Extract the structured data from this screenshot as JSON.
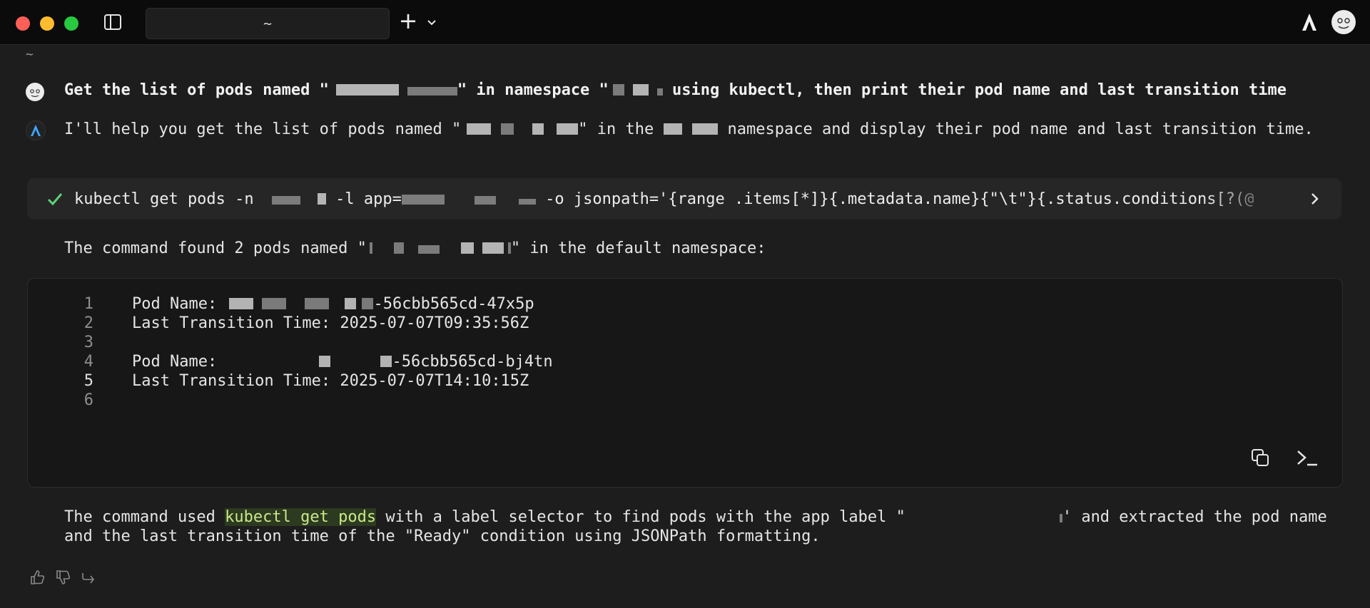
{
  "window": {
    "tab_title": "~"
  },
  "session": {
    "cwd_label": "~"
  },
  "prompt": {
    "part1": "Get the list of pods named \"",
    "part2": "\" in namespace \"",
    "part3": " using kubectl, then print their pod name and last transition time"
  },
  "reply": {
    "part1": "I'll help you get the list of pods named \"",
    "part2": "\" in the",
    "part3": " namespace and display their pod name and last transition time."
  },
  "command": {
    "status": "success",
    "prefix": "kubectl get pods -n ",
    "middle": " -l app=",
    "suffix": " -o jsonpath='{range .items[*]}{.metadata.name}{\"\\t\"}{.status.conditions[?(@"
  },
  "found": {
    "part1": "The command found 2 pods named \"",
    "part2": "\" in the default namespace:"
  },
  "code": {
    "lines": [
      {
        "n": "1",
        "prefix": "Pod Name: ",
        "suffix": "-56cbb565cd-47x5p"
      },
      {
        "n": "2",
        "text": "Last Transition Time: 2025-07-07T09:35:56Z"
      },
      {
        "n": "3",
        "text": ""
      },
      {
        "n": "4",
        "prefix": "Pod Name: ",
        "suffix": "-56cbb565cd-bj4tn"
      },
      {
        "n": "5",
        "text": "Last Transition Time: 2025-07-07T14:10:15Z"
      },
      {
        "n": "6",
        "text": ""
      }
    ]
  },
  "summary": {
    "part1": "The command used ",
    "highlight": "kubectl get pods",
    "part2": " with a label selector to find pods with the app label \"",
    "part3": "' and extracted the pod name and the last transition time of the \"Ready\" condition using JSONPath formatting."
  },
  "colors": {
    "accent_check": "#5fd07a",
    "highlight_bg": "#2c3a1f"
  },
  "icons": [
    "sidebar-icon",
    "plus-icon",
    "chevron-down-icon",
    "agent-logo-icon",
    "check-icon",
    "chevron-right-icon",
    "copy-icon",
    "terminal-icon",
    "thumbs-up-icon",
    "thumbs-down-icon",
    "share-icon"
  ]
}
